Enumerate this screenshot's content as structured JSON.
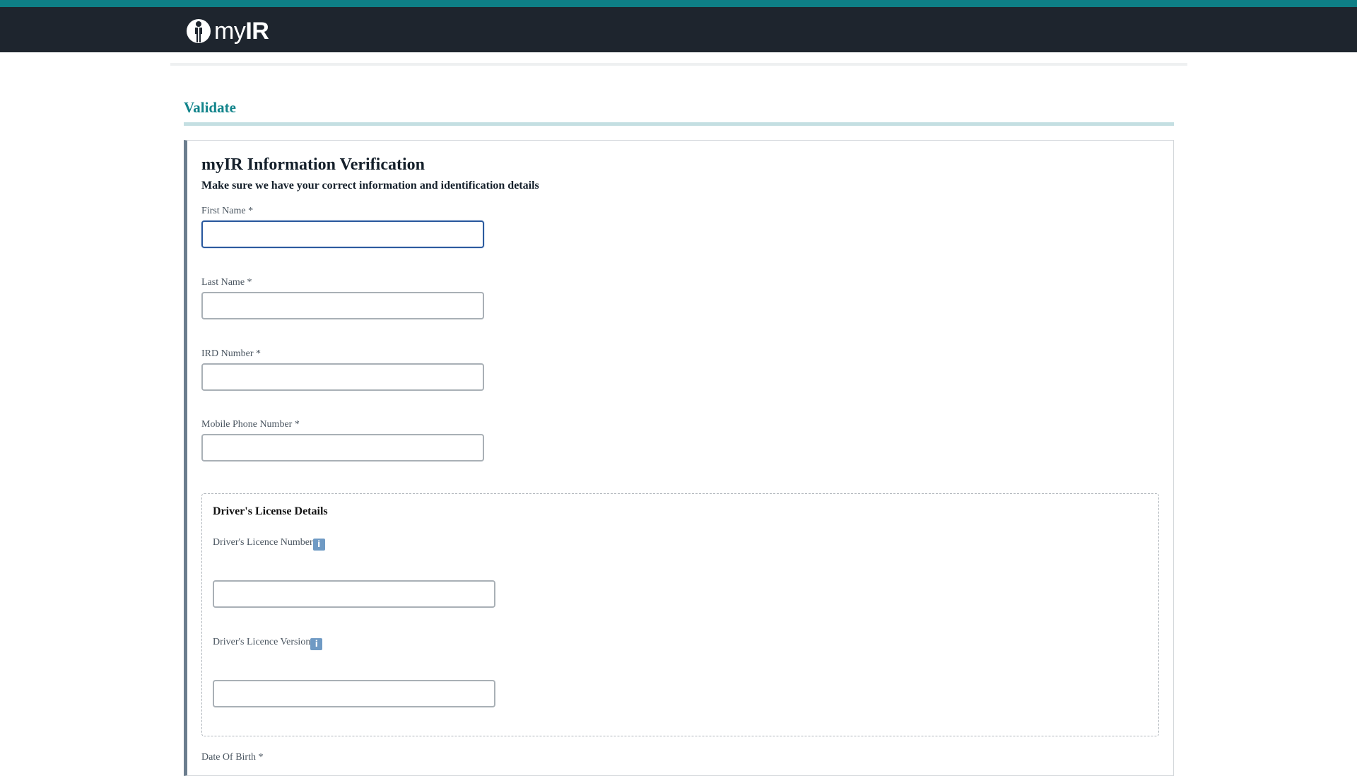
{
  "header": {
    "logo_text_light": "my",
    "logo_text_bold": "IR",
    "brand_color": "#0e7f86",
    "bar_color": "#1e252e"
  },
  "page": {
    "heading": "Validate"
  },
  "form": {
    "title": "myIR Information Verification",
    "subtitle": "Make sure we have your correct information and identification details",
    "fields": {
      "first_name": {
        "label": "First Name *",
        "value": ""
      },
      "last_name": {
        "label": "Last Name *",
        "value": ""
      },
      "ird_number": {
        "label": "IRD Number *",
        "value": ""
      },
      "mobile_phone": {
        "label": "Mobile Phone Number *",
        "value": ""
      }
    },
    "drivers_license": {
      "title": "Driver's License Details",
      "licence_number": {
        "label": "Driver's Licence Number",
        "value": "",
        "icon": "info-icon"
      },
      "licence_version": {
        "label": "Driver's Licence Version",
        "value": "",
        "icon": "info-icon"
      }
    },
    "date_of_birth": {
      "label": "Date Of Birth *"
    }
  },
  "icons": {
    "info_glyph": "i"
  }
}
